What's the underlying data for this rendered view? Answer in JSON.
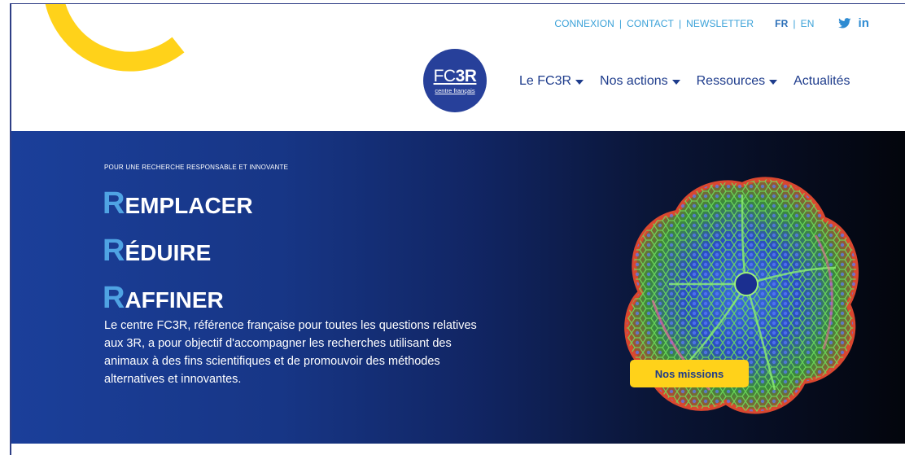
{
  "header": {
    "utility_links": [
      "CONNEXION",
      "CONTACT",
      "NEWSLETTER"
    ],
    "separator": "|",
    "languages": {
      "active": "FR",
      "other": "EN"
    },
    "social": {
      "twitter_icon": "twitter-bird-icon",
      "linkedin_label": "in"
    },
    "logo": {
      "prefix": "FC",
      "suffix": "3R",
      "subtitle": "centre français"
    },
    "nav": [
      {
        "label": "Le FC3R",
        "dropdown": true
      },
      {
        "label": "Nos actions",
        "dropdown": true
      },
      {
        "label": "Ressources",
        "dropdown": true
      },
      {
        "label": "Actualités",
        "dropdown": false
      }
    ]
  },
  "hero": {
    "kicker": "POUR UNE RECHERCHE RESPONSABLE ET INNOVANTE",
    "words": [
      {
        "initial": "R",
        "rest": "EMPLACER"
      },
      {
        "initial": "R",
        "rest": "ÉDUIRE"
      },
      {
        "initial": "R",
        "rest": "AFFINER"
      }
    ],
    "description": "Le centre FC3R, référence française pour toutes les questions relatives aux 3R, a pour objectif d'accompagner les recherches utilisant des animaux à des fins scientifiques et de promouvoir des méthodes alternatives et innovantes.",
    "cta_label": "Nos missions"
  },
  "colors": {
    "accent_yellow": "#ffd21a",
    "brand_blue": "#27409a",
    "link_blue": "#3aa1d8",
    "hero_initial_blue": "#4fa3e3"
  }
}
